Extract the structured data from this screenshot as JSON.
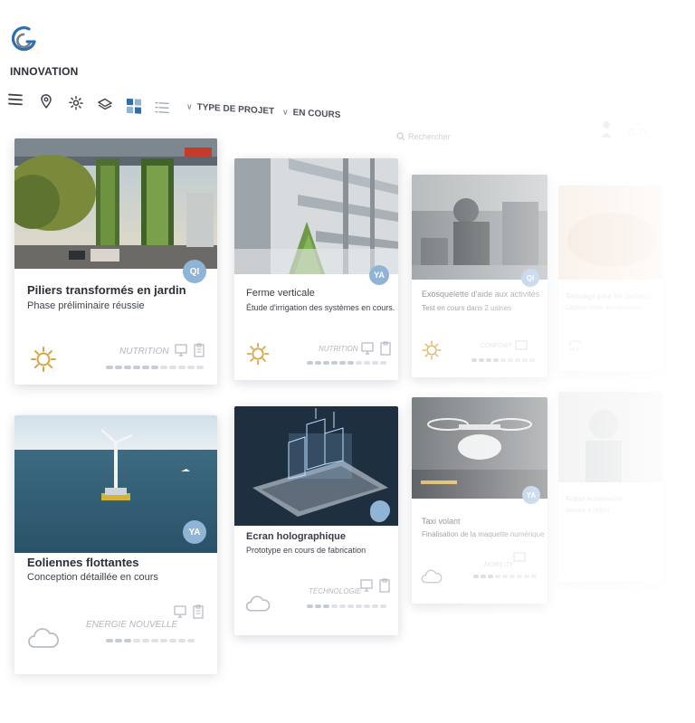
{
  "brand": {
    "name": "INNOVATION",
    "logo_icon": "g-swirl-logo",
    "colors": {
      "blue": "#2a6fb6",
      "gray": "#7a8088"
    }
  },
  "toolbar": {
    "icons": [
      "menu-icon",
      "map-pin-icon",
      "gear-icon",
      "layers-icon",
      "grid-view-icon",
      "list-view-icon"
    ],
    "filters": [
      {
        "label": "TYPE DE PROJET"
      },
      {
        "label": "EN COURS"
      }
    ]
  },
  "search": {
    "placeholder": "Rechercher"
  },
  "accent": {
    "badge": "#8fb4d6",
    "sun": "#d9a441",
    "cloud": "#b8bec6"
  },
  "cards": [
    {
      "title": "Piliers transformés en jardin",
      "subtitle": "Phase préliminaire réussie",
      "category": "NUTRITION",
      "badge": "QI",
      "weather": "sun-icon",
      "progress": 0.55
    },
    {
      "title": "Ferme verticale",
      "subtitle": "Étude d'irrigation des systèmes en cours.",
      "category": "NUTRITION",
      "badge": "YA",
      "weather": "sun-icon",
      "progress": 0.55
    },
    {
      "title": "Exosquelette d'aide aux activités",
      "subtitle": "Test en cours dans 2 usines",
      "category": "CONFORT",
      "badge": "QI",
      "weather": "sun-icon",
      "progress": 0.45
    },
    {
      "title": "Tatouage pour les patients",
      "subtitle": "Capture fixée des données",
      "category": "",
      "badge": "",
      "weather": "rain-icon",
      "progress": 0.3
    },
    {
      "title": "Eoliennes flottantes",
      "subtitle": "Conception détaillée en cours",
      "category": "ENERGIE NOUVELLE",
      "badge": "YA",
      "weather": "cloud-icon",
      "progress": 0.3
    },
    {
      "title": "Ecran holographique",
      "subtitle": "Prototype en cours de fabrication",
      "category": "TECHNOLOGIE",
      "badge": "",
      "weather": "cloud-icon",
      "progress": 0.3
    },
    {
      "title": "Taxi volant",
      "subtitle": "Finalisation de la maquette numérique",
      "category": "MOBILITE",
      "badge": "YA",
      "weather": "cloud-icon",
      "progress": 0.3
    },
    {
      "title": "Robot humanoïde",
      "subtitle": "service à l'hôtel",
      "category": "",
      "badge": "",
      "weather": "",
      "progress": 0.2
    }
  ]
}
